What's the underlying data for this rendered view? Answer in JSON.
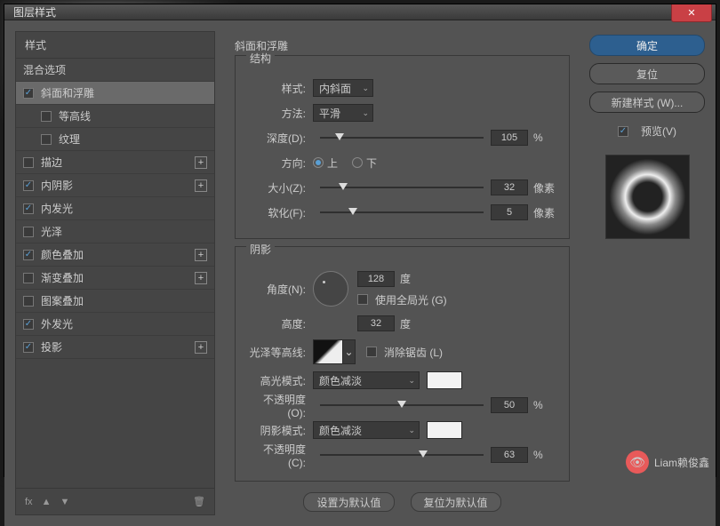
{
  "title": "图层样式",
  "left": {
    "header": "样式",
    "blend": "混合选项",
    "items": [
      {
        "label": "斜面和浮雕",
        "checked": true,
        "sel": true,
        "plus": false,
        "sub": false
      },
      {
        "label": "等高线",
        "checked": false,
        "sel": false,
        "plus": false,
        "sub": true
      },
      {
        "label": "纹理",
        "checked": false,
        "sel": false,
        "plus": false,
        "sub": true
      },
      {
        "label": "描边",
        "checked": false,
        "sel": false,
        "plus": true,
        "sub": false
      },
      {
        "label": "内阴影",
        "checked": true,
        "sel": false,
        "plus": true,
        "sub": false
      },
      {
        "label": "内发光",
        "checked": true,
        "sel": false,
        "plus": false,
        "sub": false
      },
      {
        "label": "光泽",
        "checked": false,
        "sel": false,
        "plus": false,
        "sub": false
      },
      {
        "label": "颜色叠加",
        "checked": true,
        "sel": false,
        "plus": true,
        "sub": false
      },
      {
        "label": "渐变叠加",
        "checked": false,
        "sel": false,
        "plus": true,
        "sub": false
      },
      {
        "label": "图案叠加",
        "checked": false,
        "sel": false,
        "plus": false,
        "sub": false
      },
      {
        "label": "外发光",
        "checked": true,
        "sel": false,
        "plus": false,
        "sub": false
      },
      {
        "label": "投影",
        "checked": true,
        "sel": false,
        "plus": true,
        "sub": false
      }
    ],
    "fx": "fx"
  },
  "mid": {
    "title": "斜面和浮雕",
    "structure": {
      "legend": "结构",
      "style_lbl": "样式:",
      "style_val": "内斜面",
      "method_lbl": "方法:",
      "method_val": "平滑",
      "depth_lbl": "深度(D):",
      "depth_val": "105",
      "depth_unit": "%",
      "dir_lbl": "方向:",
      "dir_up": "上",
      "dir_down": "下",
      "size_lbl": "大小(Z):",
      "size_val": "32",
      "size_unit": "像素",
      "soft_lbl": "软化(F):",
      "soft_val": "5",
      "soft_unit": "像素"
    },
    "shading": {
      "legend": "阴影",
      "angle_lbl": "角度(N):",
      "angle_val": "128",
      "angle_unit": "度",
      "global_lbl": "使用全局光 (G)",
      "alt_lbl": "高度:",
      "alt_val": "32",
      "alt_unit": "度",
      "gloss_lbl": "光泽等高线:",
      "aa_lbl": "消除锯齿 (L)",
      "hmode_lbl": "高光模式:",
      "hmode_val": "颜色减淡",
      "hop_lbl": "不透明度(O):",
      "hop_val": "50",
      "hop_unit": "%",
      "smode_lbl": "阴影模式:",
      "smode_val": "颜色减淡",
      "sop_lbl": "不透明度(C):",
      "sop_val": "63",
      "sop_unit": "%"
    },
    "btn_default": "设置为默认值",
    "btn_reset": "复位为默认值"
  },
  "right": {
    "ok": "确定",
    "cancel": "复位",
    "new": "新建样式 (W)...",
    "preview": "预览(V)"
  },
  "watermark": "Liam赖俊鑫"
}
